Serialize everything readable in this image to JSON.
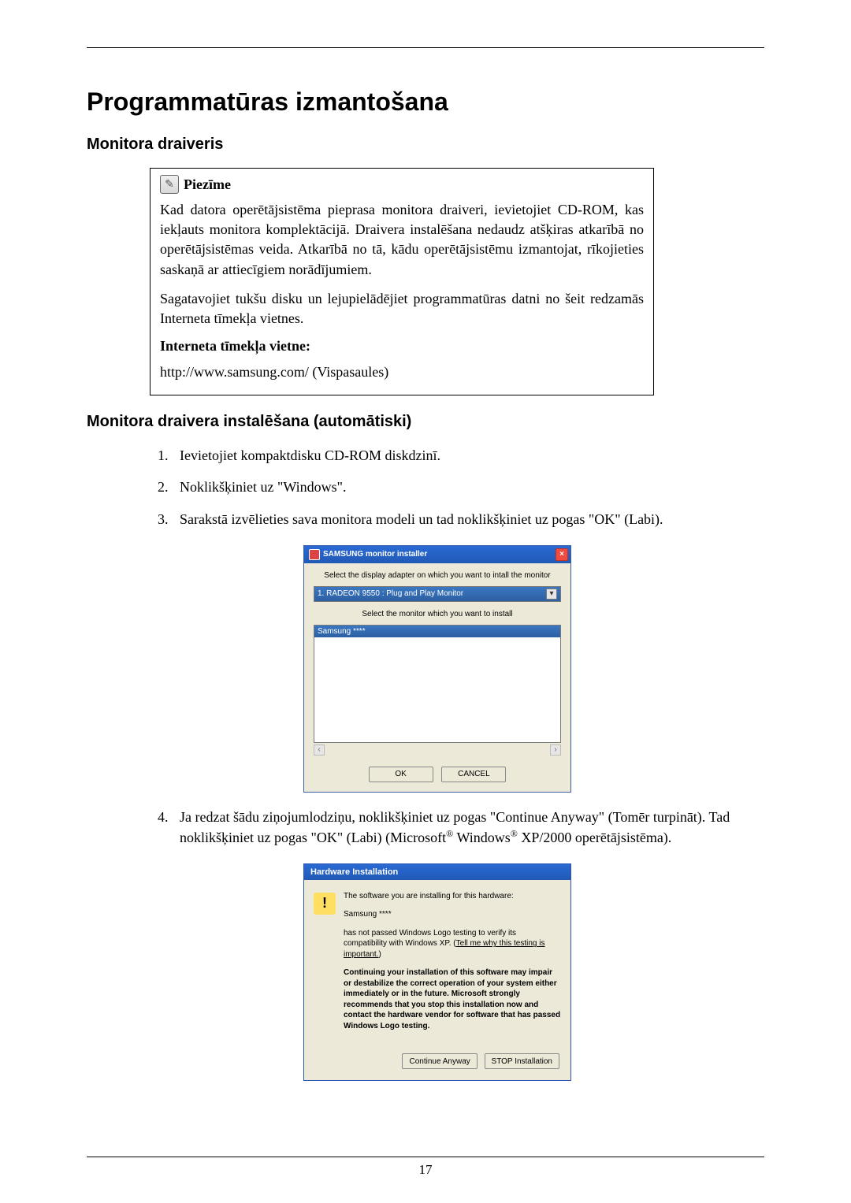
{
  "page": {
    "number": "17"
  },
  "title": "Programmatūras izmantošana",
  "section1": "Monitora draiveris",
  "note": {
    "label": "Piezīme",
    "p1": "Kad datora operētājsistēma pieprasa monitora draiveri, ievietojiet CD-ROM, kas iekļauts monitora komplektācijā. Draivera instalēšana nedaudz atšķiras atkarībā no operētājsistēmas veida. Atkarībā no tā, kādu operētājsistēmu izmantojat, rīkojieties saskaņā ar attiecīgiem norādījumiem.",
    "p2": "Sagatavojiet tukšu disku un lejupielādējiet programmatūras datni no šeit redzamās Interneta tīmekļa vietnes.",
    "site_label": "Interneta tīmekļa vietne:",
    "url": "http://www.samsung.com/ (Vispasaules)"
  },
  "section2": "Monitora draivera instalēšana (automātiski)",
  "steps": {
    "s1": "Ievietojiet kompaktdisku CD-ROM diskdzinī.",
    "s2": "Noklikšķiniet uz \"Windows\".",
    "s3": "Sarakstā izvēlieties sava monitora modeli un tad noklikšķiniet uz pogas \"OK\" (Labi).",
    "s4a": "Ja redzat šādu ziņojumlodziņu, noklikšķiniet uz pogas \"Continue Anyway\" (Tomēr turpināt). Tad noklikšķiniet uz pogas \"OK\" (Labi) (Microsoft",
    "s4b": " Windows",
    "s4c": " XP/2000 operētājsistēma).",
    "reg": "®"
  },
  "dlg1": {
    "title": "SAMSUNG monitor installer",
    "close": "×",
    "label1": "Select the display adapter on which you want to intall the monitor",
    "select": "1. RADEON 9550 : Plug and Play Monitor",
    "caret": "▾",
    "label2": "Select the monitor which you want to install",
    "item": "Samsung ****",
    "left": "‹",
    "right": "›",
    "ok": "OK",
    "cancel": "CANCEL"
  },
  "dlg2": {
    "title": "Hardware Installation",
    "icon": "!",
    "p1": "The software you are installing for this hardware:",
    "p2": "Samsung ****",
    "p3a": "has not passed Windows Logo testing to verify its compatibility with Windows XP. (",
    "p3_link": "Tell me why this testing is important.",
    "p3b": ")",
    "p4": "Continuing your installation of this software may impair or destabilize the correct operation of your system either immediately or in the future. Microsoft strongly recommends that you stop this installation now and contact the hardware vendor for software that has passed Windows Logo testing.",
    "btn_continue": "Continue Anyway",
    "btn_stop": "STOP Installation"
  }
}
